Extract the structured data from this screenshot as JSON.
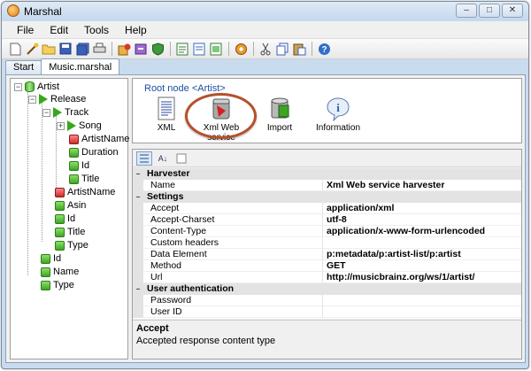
{
  "window": {
    "title": "Marshal"
  },
  "menu": [
    "File",
    "Edit",
    "Tools",
    "Help"
  ],
  "toolbar_icons": [
    "new-document-icon",
    "wizard-icon",
    "open-folder-icon",
    "save-icon",
    "save-all-icon",
    "print-icon",
    "harvest-icon",
    "export-icon",
    "shield-icon",
    "form-icon",
    "form-edit-icon",
    "form-preview-icon",
    "settings-icon",
    "cut-icon",
    "copy-icon",
    "paste-icon",
    "help-icon"
  ],
  "tabs": [
    "Start",
    "Music.marshal"
  ],
  "tree": {
    "root": "Artist",
    "items": [
      {
        "label": "Release"
      },
      {
        "label": "Track"
      },
      {
        "label": "Song"
      },
      {
        "label": "ArtistName"
      },
      {
        "label": "Duration"
      },
      {
        "label": "Id"
      },
      {
        "label": "Title"
      },
      {
        "label": "ArtistName"
      },
      {
        "label": "Asin"
      },
      {
        "label": "Id"
      },
      {
        "label": "Title"
      },
      {
        "label": "Type"
      },
      {
        "label": "Id"
      },
      {
        "label": "Name"
      },
      {
        "label": "Type"
      }
    ]
  },
  "root_node": "Root node <Artist>",
  "actions": [
    {
      "label": "XML",
      "icon": "xml-document-icon"
    },
    {
      "label": "Xml Web service",
      "icon": "xml-web-service-icon"
    },
    {
      "label": "Import",
      "icon": "import-database-icon"
    },
    {
      "label": "Information",
      "icon": "information-icon"
    }
  ],
  "properties": {
    "categories": {
      "harvester": "Harvester",
      "settings": "Settings",
      "user_auth": "User authentication"
    },
    "rows": {
      "name": {
        "name": "Name",
        "value": "Xml Web service harvester"
      },
      "accept": {
        "name": "Accept",
        "value": "application/xml"
      },
      "accept_charset": {
        "name": "Accept-Charset",
        "value": "utf-8"
      },
      "content_type": {
        "name": "Content-Type",
        "value": "application/x-www-form-urlencoded"
      },
      "custom_headers": {
        "name": "Custom headers",
        "value": ""
      },
      "data_element": {
        "name": "Data Element",
        "value": "p:metadata/p:artist-list/p:artist"
      },
      "method": {
        "name": "Method",
        "value": "GET"
      },
      "url": {
        "name": "Url",
        "value": "http://musicbrainz.org/ws/1/artist/"
      },
      "password": {
        "name": "Password",
        "value": ""
      },
      "user_id": {
        "name": "User ID",
        "value": ""
      }
    }
  },
  "description": {
    "title": "Accept",
    "text": "Accepted response content type"
  }
}
